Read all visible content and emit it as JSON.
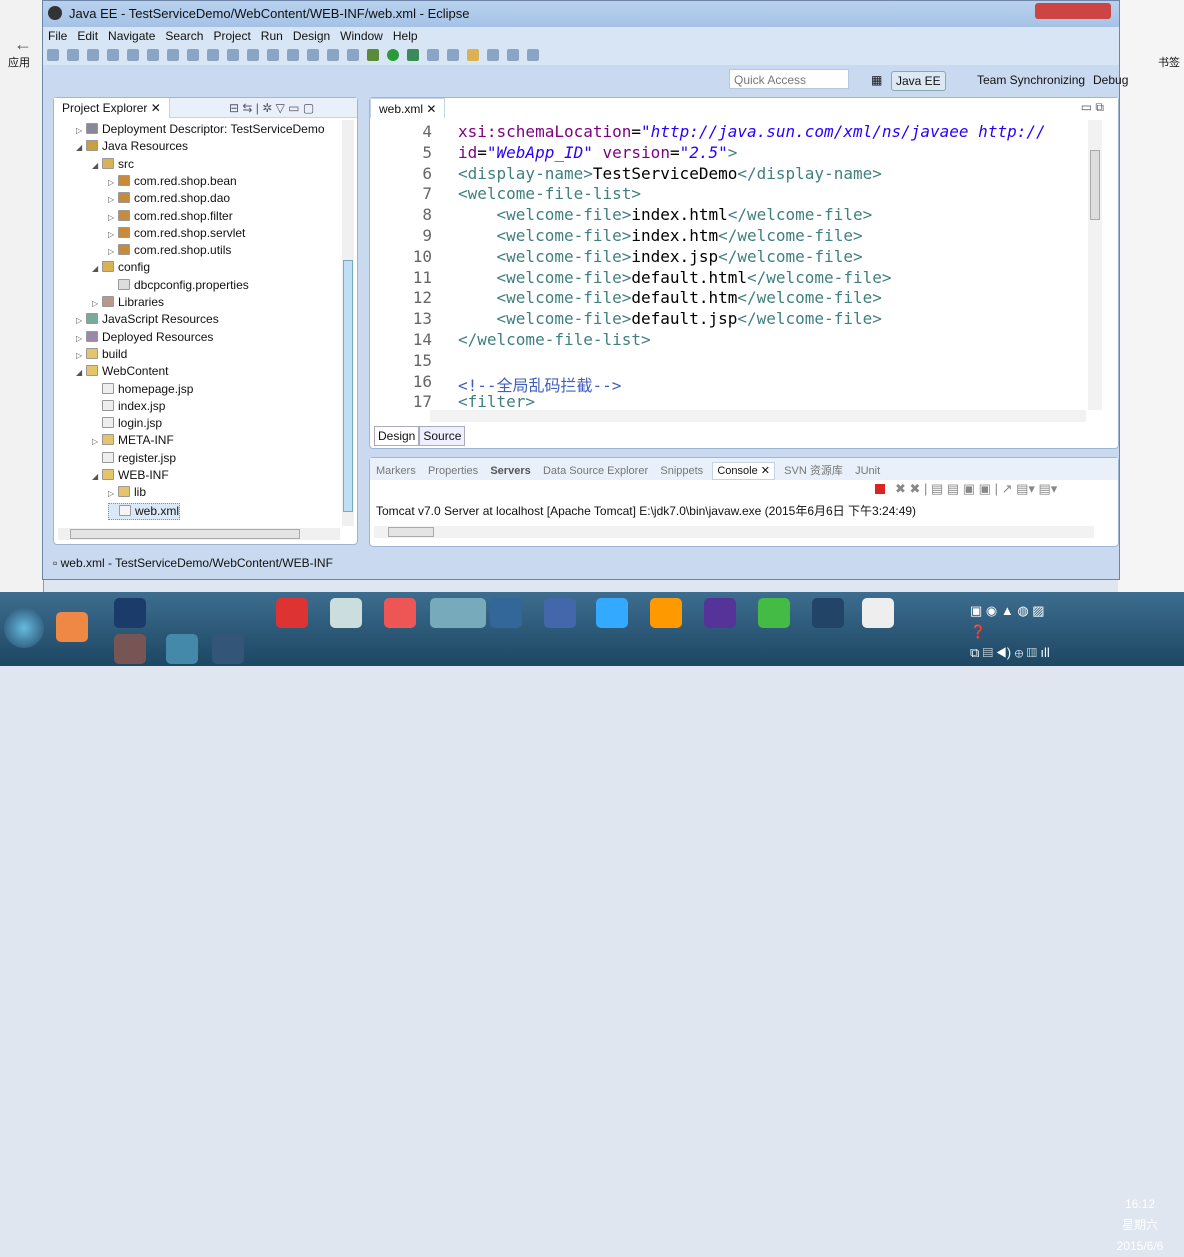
{
  "window": {
    "title": "Java EE - TestServiceDemo/WebContent/WEB-INF/web.xml - Eclipse"
  },
  "menu": [
    "File",
    "Edit",
    "Navigate",
    "Search",
    "Project",
    "Run",
    "Design",
    "Window",
    "Help"
  ],
  "quick_access": {
    "placeholder": "Quick Access"
  },
  "perspectives": [
    "Java EE",
    "Team Synchronizing",
    "Debug"
  ],
  "project_explorer": {
    "title": "Project Explorer",
    "items": [
      {
        "label": "Deployment Descriptor: TestServiceDemo",
        "level": 1,
        "expanded": false,
        "icon": "descriptor-icon"
      },
      {
        "label": "Java Resources",
        "level": 1,
        "expanded": true,
        "icon": "java-resources-icon"
      },
      {
        "label": "src",
        "level": 2,
        "expanded": true,
        "icon": "source-folder-icon"
      },
      {
        "label": "com.red.shop.bean",
        "level": 3,
        "expanded": false,
        "icon": "package-icon"
      },
      {
        "label": "com.red.shop.dao",
        "level": 3,
        "expanded": false,
        "icon": "package-icon"
      },
      {
        "label": "com.red.shop.filter",
        "level": 3,
        "expanded": false,
        "icon": "package-icon"
      },
      {
        "label": "com.red.shop.servlet",
        "level": 3,
        "expanded": false,
        "icon": "package-icon"
      },
      {
        "label": "com.red.shop.utils",
        "level": 3,
        "expanded": false,
        "icon": "package-icon"
      },
      {
        "label": "config",
        "level": 2,
        "expanded": true,
        "icon": "source-folder-icon"
      },
      {
        "label": "dbcpconfig.properties",
        "level": 3,
        "icon": "file-icon"
      },
      {
        "label": "Libraries",
        "level": 2,
        "expanded": false,
        "icon": "library-icon"
      },
      {
        "label": "JavaScript Resources",
        "level": 1,
        "expanded": false,
        "icon": "js-resources-icon"
      },
      {
        "label": "Deployed Resources",
        "level": 1,
        "expanded": false,
        "icon": "deployed-icon"
      },
      {
        "label": "build",
        "level": 1,
        "expanded": false,
        "icon": "folder-icon"
      },
      {
        "label": "WebContent",
        "level": 1,
        "expanded": true,
        "icon": "folder-icon"
      },
      {
        "label": "homepage.jsp",
        "level": 2,
        "icon": "jsp-icon"
      },
      {
        "label": "index.jsp",
        "level": 2,
        "icon": "jsp-icon"
      },
      {
        "label": "login.jsp",
        "level": 2,
        "icon": "jsp-icon"
      },
      {
        "label": "META-INF",
        "level": 2,
        "expanded": false,
        "icon": "folder-icon"
      },
      {
        "label": "register.jsp",
        "level": 2,
        "icon": "jsp-icon"
      },
      {
        "label": "WEB-INF",
        "level": 2,
        "expanded": true,
        "icon": "folder-icon"
      },
      {
        "label": "lib",
        "level": 3,
        "expanded": false,
        "icon": "folder-icon"
      },
      {
        "label": "web.xml",
        "level": 3,
        "icon": "xml-icon",
        "selected": true
      }
    ]
  },
  "editor": {
    "tab": "web.xml",
    "bottom_tabs": [
      "Design",
      "Source"
    ],
    "lines": [
      {
        "n": "4",
        "seg": [
          [
            "a",
            "xsi:schemaLocation"
          ],
          [
            "x",
            "="
          ],
          [
            "v",
            "\"http://java.sun.com/xml/ns/javaee http://"
          ]
        ]
      },
      {
        "n": "5",
        "seg": [
          [
            "a",
            "id"
          ],
          [
            "x",
            "="
          ],
          [
            "v",
            "\"WebApp_ID\""
          ],
          [
            "x",
            " "
          ],
          [
            "a",
            "version"
          ],
          [
            "x",
            "="
          ],
          [
            "v",
            "\"2.5\""
          ],
          [
            "t",
            ">"
          ]
        ]
      },
      {
        "n": "6",
        "seg": [
          [
            "t",
            "<display-name>"
          ],
          [
            "x",
            "TestServiceDemo"
          ],
          [
            "t",
            "</display-name>"
          ]
        ]
      },
      {
        "n": "7",
        "seg": [
          [
            "t",
            "<welcome-file-list>"
          ]
        ]
      },
      {
        "n": "8",
        "seg": [
          [
            "x",
            "    "
          ],
          [
            "t",
            "<welcome-file>"
          ],
          [
            "x",
            "index.html"
          ],
          [
            "t",
            "</welcome-file>"
          ]
        ]
      },
      {
        "n": "9",
        "seg": [
          [
            "x",
            "    "
          ],
          [
            "t",
            "<welcome-file>"
          ],
          [
            "x",
            "index.htm"
          ],
          [
            "t",
            "</welcome-file>"
          ]
        ]
      },
      {
        "n": "10",
        "seg": [
          [
            "x",
            "    "
          ],
          [
            "t",
            "<welcome-file>"
          ],
          [
            "x",
            "index.jsp"
          ],
          [
            "t",
            "</welcome-file>"
          ]
        ]
      },
      {
        "n": "11",
        "seg": [
          [
            "x",
            "    "
          ],
          [
            "t",
            "<welcome-file>"
          ],
          [
            "x",
            "default.html"
          ],
          [
            "t",
            "</welcome-file>"
          ]
        ]
      },
      {
        "n": "12",
        "seg": [
          [
            "x",
            "    "
          ],
          [
            "t",
            "<welcome-file>"
          ],
          [
            "x",
            "default.htm"
          ],
          [
            "t",
            "</welcome-file>"
          ]
        ]
      },
      {
        "n": "13",
        "seg": [
          [
            "x",
            "    "
          ],
          [
            "t",
            "<welcome-file>"
          ],
          [
            "x",
            "default.jsp"
          ],
          [
            "t",
            "</welcome-file>"
          ]
        ]
      },
      {
        "n": "14",
        "seg": [
          [
            "t",
            "</welcome-file-list>"
          ]
        ]
      },
      {
        "n": "15",
        "seg": []
      },
      {
        "n": "16",
        "seg": [
          [
            "c",
            "<!--全局乱码拦截-->"
          ]
        ]
      },
      {
        "n": "17",
        "seg": [
          [
            "t",
            "<filter>"
          ]
        ]
      }
    ]
  },
  "console": {
    "tabs": [
      "Markers",
      "Properties",
      "Servers",
      "Data Source Explorer",
      "Snippets",
      "Console",
      "SVN 资源库",
      "JUnit"
    ],
    "active": "Console",
    "header": "Tomcat v7.0 Server at localhost [Apache Tomcat] E:\\jdk7.0\\bin\\javaw.exe (2015年6月6日 下午3:24:49)"
  },
  "status": {
    "text": "web.xml - TestServiceDemo/WebContent/WEB-INF"
  },
  "browser": {
    "bookmark_label": "应用",
    "right_label": "书签"
  },
  "clock": {
    "time": "16:12",
    "weekday": "星期六",
    "date": "2015/6/6"
  }
}
